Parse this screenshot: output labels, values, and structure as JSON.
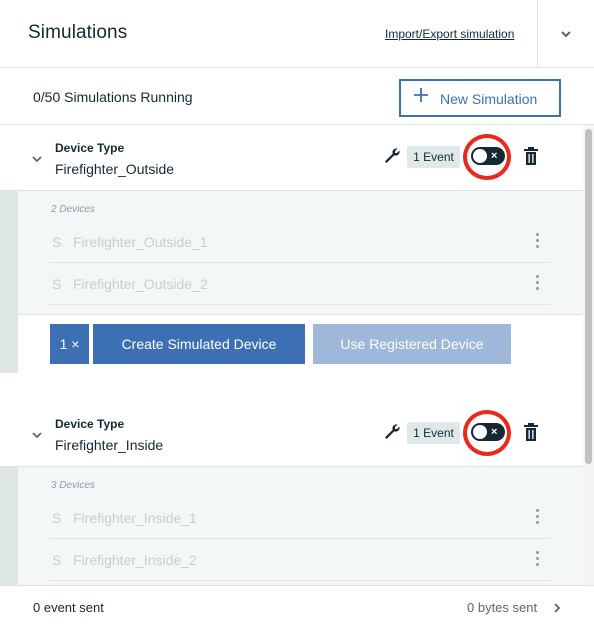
{
  "header": {
    "title": "Simulations",
    "import_export_label": "Import/Export simulation"
  },
  "subheader": {
    "running_text": "0/50 Simulations Running",
    "new_simulation_label": "New Simulation"
  },
  "simulations": [
    {
      "device_type_label": "Device Type",
      "device_type": "Firefighter_Outside",
      "event_badge": "1 Event",
      "devices_count": "2 Devices",
      "devices": [
        {
          "initial": "S",
          "name": "Firefighter_Outside_1"
        },
        {
          "initial": "S",
          "name": "Firefighter_Outside_2"
        }
      ],
      "quantity_label": "1 ×",
      "create_label": "Create Simulated Device",
      "use_registered_label": "Use Registered Device"
    },
    {
      "device_type_label": "Device Type",
      "device_type": "Firefighter_Inside",
      "event_badge": "1 Event",
      "devices_count": "3 Devices",
      "devices": [
        {
          "initial": "S",
          "name": "Firefighter_Inside_1"
        },
        {
          "initial": "S",
          "name": "Firefighter_Inside_2"
        }
      ]
    }
  ],
  "toggle_off_glyph": "×",
  "footer": {
    "events_sent": "0 event sent",
    "bytes_sent": "0 bytes sent"
  },
  "colors": {
    "primary": "#3d70b2",
    "primary_disabled": "#9fb7d9",
    "highlight": "#e8291c",
    "toggle_off": "#152935",
    "badge_bg": "#dfe9e9"
  }
}
